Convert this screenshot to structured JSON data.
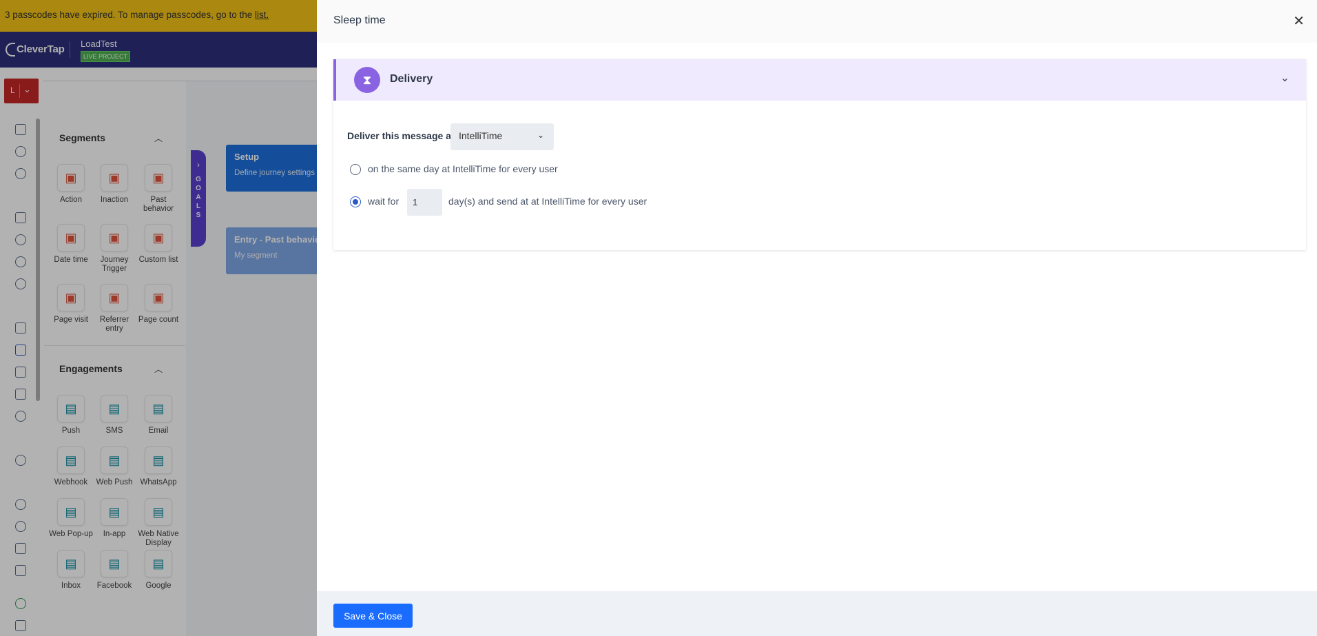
{
  "banner": {
    "text": "3 passcodes have expired. To manage passcodes, go to the ",
    "link": "list."
  },
  "topbar": {
    "logo": "CleverTap",
    "project_name": "LoadTest",
    "project_badge": "LIVE PROJECT"
  },
  "user": {
    "initial": "L"
  },
  "palette": {
    "segments_title": "Segments",
    "segments": [
      {
        "label": "Action",
        "icon": "hand-pointer-icon"
      },
      {
        "label": "Inaction",
        "icon": "hand-off-icon"
      },
      {
        "label": "Past behavior",
        "icon": "past-behavior-icon"
      },
      {
        "label": "Date time",
        "icon": "calendar-icon"
      },
      {
        "label": "Journey Trigger",
        "icon": "trigger-icon"
      },
      {
        "label": "Custom list",
        "icon": "list-icon"
      },
      {
        "label": "Page visit",
        "icon": "eye-icon"
      },
      {
        "label": "Referrer entry",
        "icon": "code-icon"
      },
      {
        "label": "Page count",
        "icon": "pages-icon"
      }
    ],
    "engagements_title": "Engagements",
    "engagements": [
      {
        "label": "Push",
        "icon": "phone-icon"
      },
      {
        "label": "SMS",
        "icon": "sms-icon"
      },
      {
        "label": "Email",
        "icon": "email-icon"
      },
      {
        "label": "Webhook",
        "icon": "webhook-icon"
      },
      {
        "label": "Web Push",
        "icon": "web-push-icon"
      },
      {
        "label": "WhatsApp",
        "icon": "whatsapp-icon"
      },
      {
        "label": "Web Pop-up",
        "icon": "popup-icon"
      },
      {
        "label": "In-app",
        "icon": "in-app-icon"
      },
      {
        "label": "Web Native Display",
        "icon": "native-display-icon"
      },
      {
        "label": "Inbox",
        "icon": "inbox-icon"
      },
      {
        "label": "Facebook",
        "icon": "facebook-icon"
      },
      {
        "label": "Google",
        "icon": "google-ads-icon"
      }
    ]
  },
  "canvas": {
    "goals_label": "GOALS",
    "setup_title": "Setup",
    "setup_sub": "Define journey settings",
    "entry_title": "Entry - Past behavior",
    "entry_sub": "My segment"
  },
  "panel": {
    "title": "Sleep time",
    "section_title": "Delivery",
    "deliver_label": "Deliver this message at",
    "deliver_value": "IntelliTime",
    "option1_text": "on the same day at IntelliTime for every user",
    "option2_prefix": "wait for",
    "option2_value": "1",
    "option2_suffix": "day(s) and send at at IntelliTime for every user",
    "selected_option": 2,
    "save_label": "Save & Close"
  },
  "colors": {
    "primary": "#1a6cff",
    "delivery_accent": "#8a63e3",
    "banner": "#f5c518",
    "topbar": "#2d2f7a"
  }
}
